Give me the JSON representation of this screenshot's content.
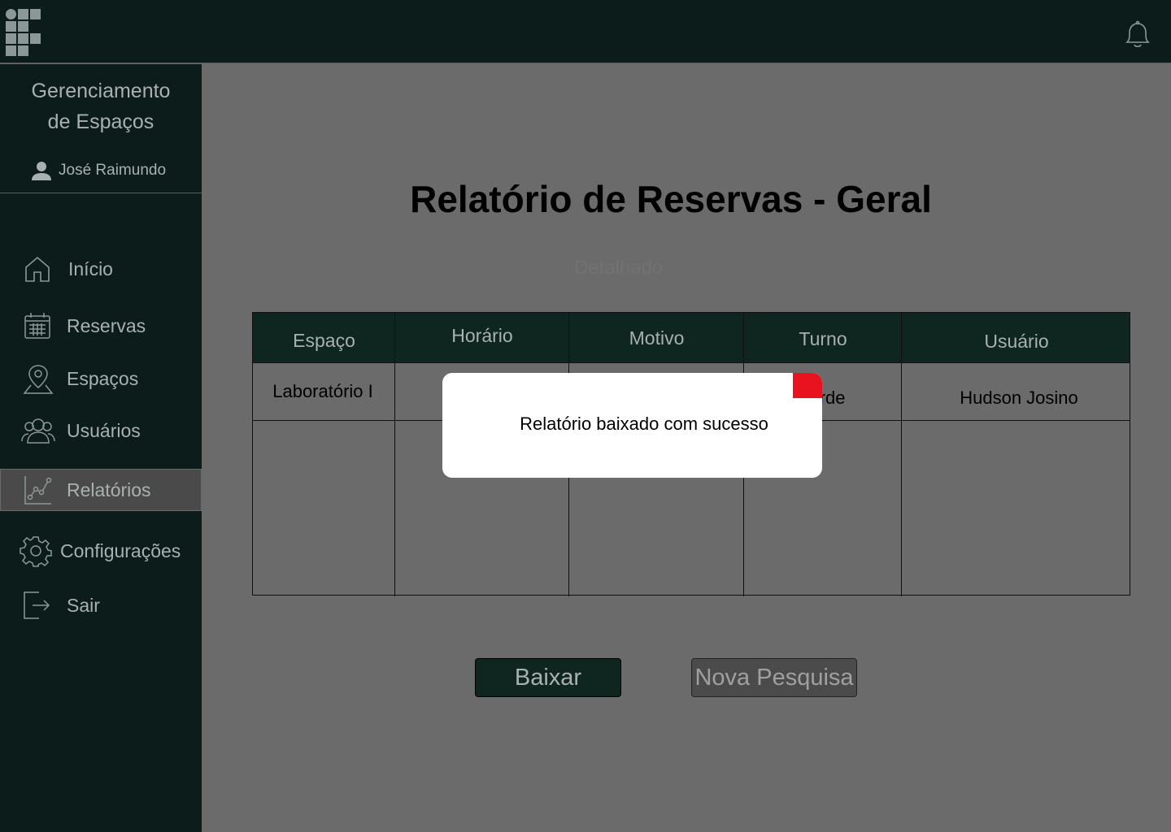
{
  "header": {
    "logo_icon": "institute-logo-icon",
    "bell_icon": "bell-icon"
  },
  "sidebar": {
    "brand_line1": "Gerenciamento",
    "brand_line2": "de Espaços",
    "user_name": "José Raimundo",
    "items": [
      {
        "label": "Início",
        "icon": "home-icon"
      },
      {
        "label": "Reservas",
        "icon": "calendar-icon"
      },
      {
        "label": "Espaços",
        "icon": "location-pin-icon"
      },
      {
        "label": "Usuários",
        "icon": "users-icon"
      },
      {
        "label": "Relatórios",
        "icon": "chart-icon",
        "active": true
      },
      {
        "label": "Configurações",
        "icon": "gear-icon"
      },
      {
        "label": "Sair",
        "icon": "logout-icon"
      }
    ]
  },
  "main": {
    "title": "Relatório de Reservas - Geral",
    "subtitle": "Detalhado",
    "table": {
      "columns": [
        "Espaço",
        "Horário",
        "Motivo",
        "Turno",
        "Usuário"
      ],
      "rows": [
        [
          "Laboratório I",
          "",
          "",
          "Tarde",
          "Hudson Josino"
        ]
      ]
    },
    "buttons": {
      "download": "Baixar",
      "new_search": "Nova Pesquisa"
    }
  },
  "modal": {
    "message": "Relatório baixado com sucesso"
  },
  "colors": {
    "sidebar_bg": "#0c1c1a",
    "header_green": "#0f2520",
    "overlay": "#6b6b6b",
    "close_red": "#e8131e"
  }
}
